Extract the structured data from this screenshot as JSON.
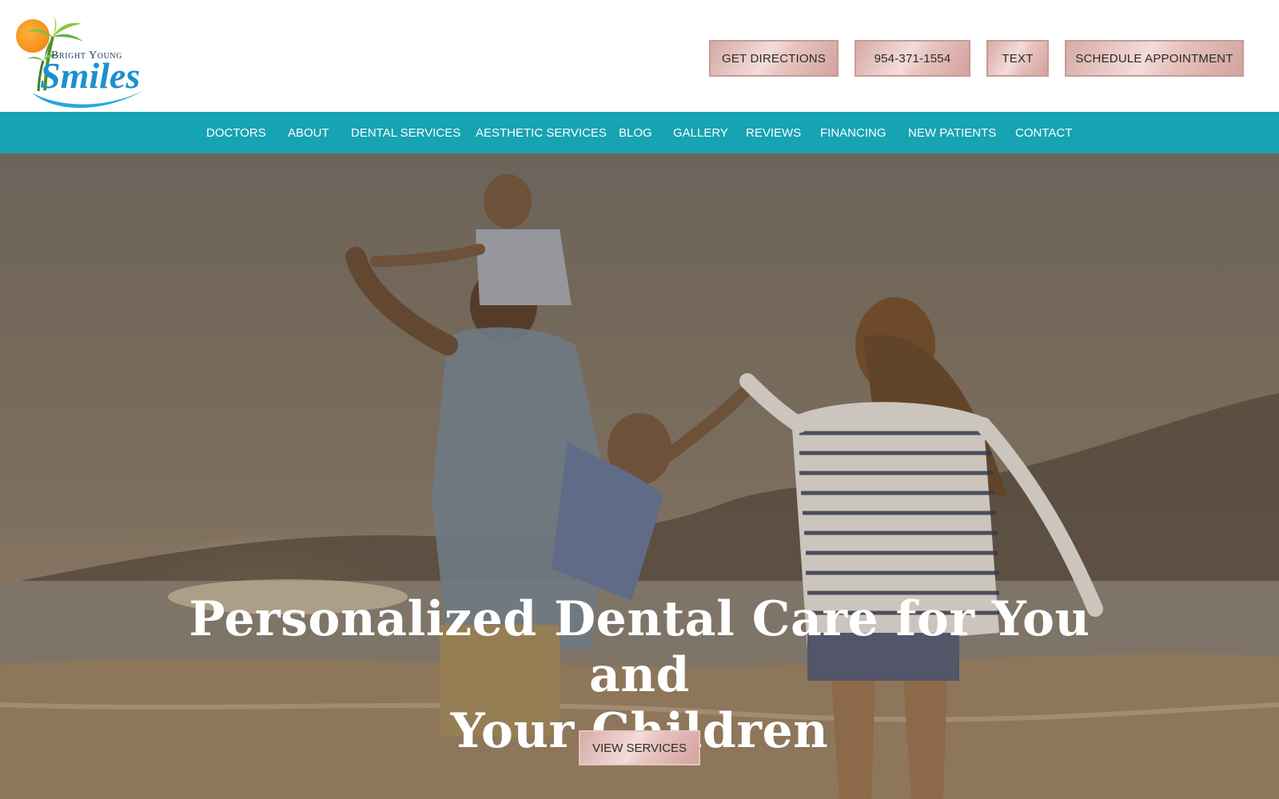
{
  "logo": {
    "line1": "Bright Young",
    "line2": "Smiles"
  },
  "top_actions": {
    "directions": "GET DIRECTIONS",
    "phone": "954-371-1554",
    "text": "TEXT",
    "schedule": "SCHEDULE APPOINTMENT"
  },
  "nav": {
    "items": [
      {
        "label": "DOCTORS"
      },
      {
        "label": "ABOUT"
      },
      {
        "label": "DENTAL SERVICES"
      },
      {
        "label": "AESTHETIC SERVICES"
      },
      {
        "label": "BLOG"
      },
      {
        "label": "GALLERY"
      },
      {
        "label": "REVIEWS"
      },
      {
        "label": "FINANCING"
      },
      {
        "label": "NEW PATIENTS"
      },
      {
        "label": "CONTACT"
      }
    ]
  },
  "hero": {
    "title_line1": "Personalized Dental Care for You and",
    "title_line2": "Your Children",
    "button": "VIEW SERVICES"
  },
  "colors": {
    "nav_bg": "#16a3b2",
    "button_rose": "#d6aba6",
    "logo_blue": "#1e8fd0"
  }
}
